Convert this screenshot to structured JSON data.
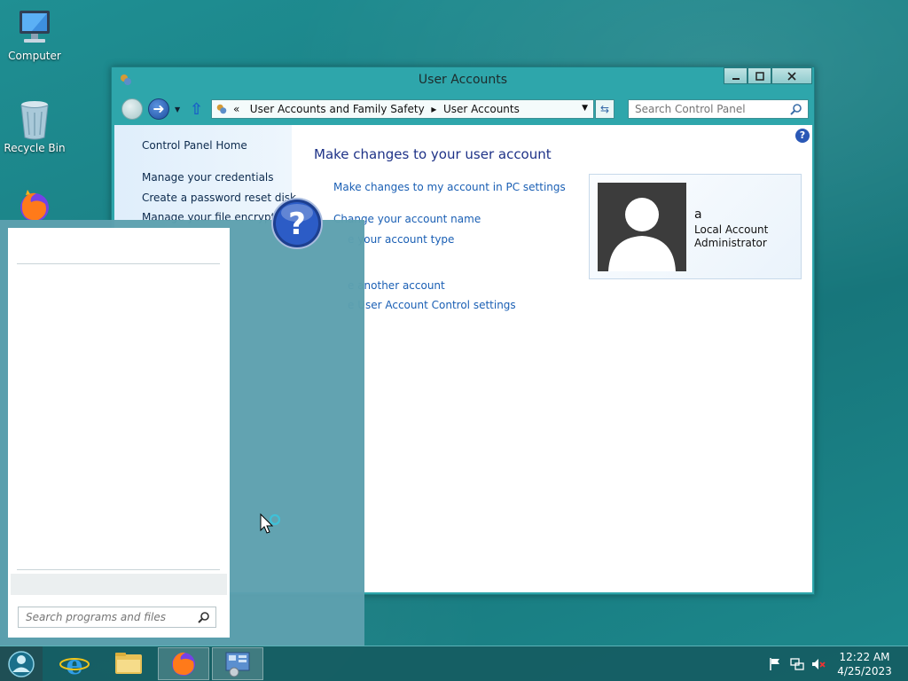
{
  "desktop": {
    "icons": [
      {
        "label": "Computer"
      },
      {
        "label": "Recycle Bin"
      }
    ]
  },
  "window": {
    "title": "User Accounts",
    "nav": {
      "address_prefix": "«",
      "crumb1": "User Accounts and Family Safety",
      "crumb_sep": "▸",
      "crumb2": "User Accounts",
      "search_placeholder": "Search Control Panel"
    },
    "left_pane": {
      "home": "Control Panel Home",
      "links": [
        "Manage your credentials",
        "Create a password reset disk",
        "Manage your file encryption"
      ]
    },
    "main": {
      "title": "Make changes to your user account",
      "pc_settings_link": "Make changes to my account in PC settings",
      "links": [
        "Change your account name",
        "e your account type",
        "e another account",
        "e User Account Control settings"
      ]
    },
    "user_card": {
      "name": "a",
      "line1": "Local Account",
      "line2": "Administrator"
    }
  },
  "start_menu": {
    "search_placeholder": "Search programs and files"
  },
  "taskbar": {
    "time": "12:22 AM",
    "date": "4/25/2023"
  }
}
